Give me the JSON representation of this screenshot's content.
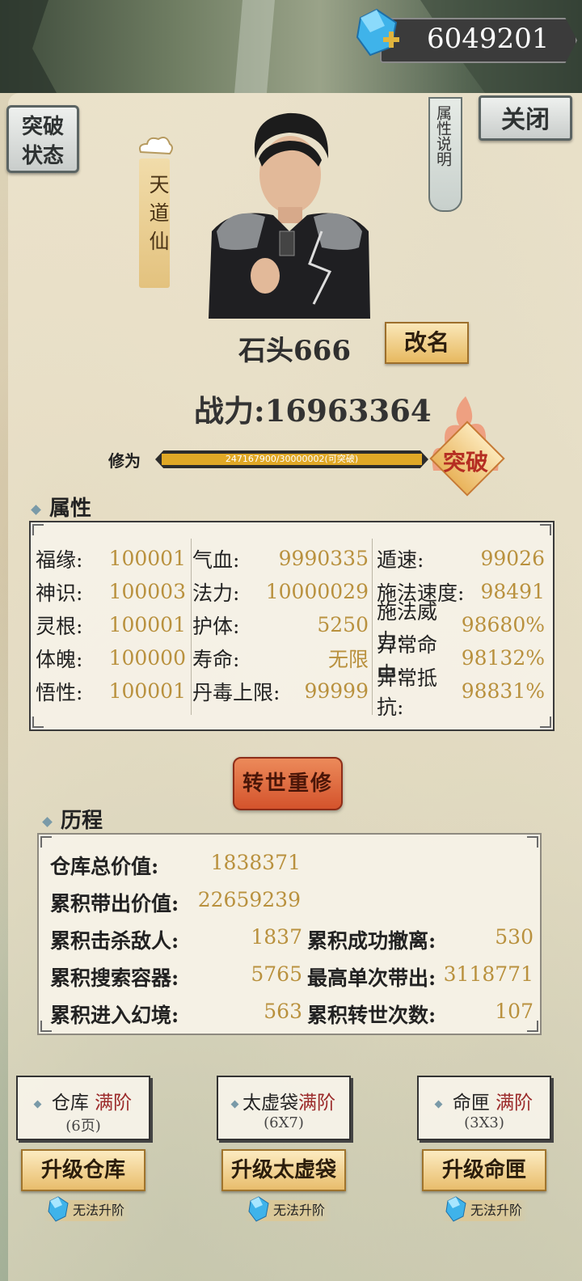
{
  "currency": {
    "amount": "6049201"
  },
  "header": {
    "breakthrough_status": "突破状态",
    "realm": "天道仙",
    "attr_help": "属性说明",
    "close": "关闭"
  },
  "profile": {
    "name": "石头666",
    "rename": "改名",
    "power": "战力:16963364",
    "cultivation_label": "修为",
    "cultivation_value": "247167900/30000002(可突破)",
    "cultivation_progress": 1.0,
    "breakthrough": "突破"
  },
  "attributes": {
    "title": "属性",
    "col1": [
      {
        "k": "福缘:",
        "v": "100001"
      },
      {
        "k": "神识:",
        "v": "100003"
      },
      {
        "k": "灵根:",
        "v": "100001"
      },
      {
        "k": "体魄:",
        "v": "100000"
      },
      {
        "k": "悟性:",
        "v": "100001"
      }
    ],
    "col2": [
      {
        "k": "气血:",
        "v": "9990335"
      },
      {
        "k": "法力:",
        "v": "10000029"
      },
      {
        "k": "护体:",
        "v": "5250"
      },
      {
        "k": "寿命:",
        "v": "无限"
      },
      {
        "k": "丹毒上限:",
        "v": "99999"
      }
    ],
    "col3": [
      {
        "k": "遁速:",
        "v": "99026"
      },
      {
        "k": "施法速度:",
        "v": "98491"
      },
      {
        "k": "施法威力:",
        "v": "98680%"
      },
      {
        "k": "异常命中:",
        "v": "98132%"
      },
      {
        "k": "异常抵抗:",
        "v": "98831%"
      }
    ]
  },
  "reincarnate": "转世重修",
  "history": {
    "title": "历程",
    "warehouse_value_label": "仓库总价值:",
    "warehouse_value": "1838371",
    "carried_value_label": "累积带出价值:",
    "carried_value": "22659239",
    "left": [
      {
        "k": "累积击杀敌人:",
        "v": "1837"
      },
      {
        "k": "累积搜索容器:",
        "v": "5765"
      },
      {
        "k": "累积进入幻境:",
        "v": "563"
      }
    ],
    "right": [
      {
        "k": "累积成功撤离:",
        "v": "530"
      },
      {
        "k": "最高单次带出:",
        "v": "3118771"
      },
      {
        "k": "累积转世次数:",
        "v": "107"
      }
    ]
  },
  "storage": [
    {
      "name": "仓库",
      "status": "满阶",
      "size": "(6页)",
      "button": "升级仓库",
      "note": "无法升阶"
    },
    {
      "name": "太虚袋",
      "status": "满阶",
      "size": "(6X7)",
      "button": "升级太虚袋",
      "note": "无法升阶"
    },
    {
      "name": "命匣",
      "status": "满阶",
      "size": "(3X3)",
      "button": "升级命匣",
      "note": "无法升阶"
    }
  ]
}
